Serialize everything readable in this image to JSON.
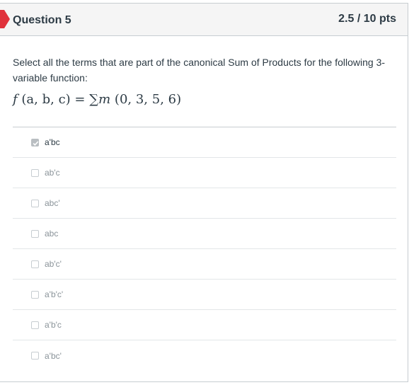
{
  "question": {
    "title": "Question 5",
    "points": "2.5 / 10 pts",
    "text": "Select all the terms that are part of the canonical Sum of Products for the following 3-variable function:",
    "formula": {
      "lhs": "f",
      "args": "(a, b, c)",
      "eq": "=",
      "sum": "∑",
      "m": "m",
      "terms": "(0, 3, 5, 6)"
    },
    "flag_color": "#e0323c"
  },
  "answers": [
    {
      "label": "a'bc",
      "checked": true
    },
    {
      "label": "ab'c",
      "checked": false
    },
    {
      "label": "abc'",
      "checked": false
    },
    {
      "label": "abc",
      "checked": false
    },
    {
      "label": "ab'c'",
      "checked": false
    },
    {
      "label": "a'b'c'",
      "checked": false
    },
    {
      "label": "a'b'c",
      "checked": false
    },
    {
      "label": "a'bc'",
      "checked": false
    }
  ]
}
